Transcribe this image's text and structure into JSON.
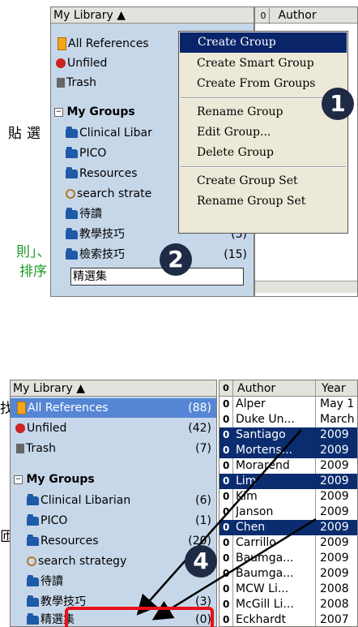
{
  "top": {
    "library_header": "My Library ▲",
    "col_author": "Author",
    "clip_header": "0",
    "nav": [
      {
        "label": "All References"
      },
      {
        "label": "Unfiled"
      },
      {
        "label": "Trash"
      }
    ],
    "groups_title": "My Groups",
    "groups": [
      {
        "label": "Clinical Libar",
        "count": ""
      },
      {
        "label": "PICO",
        "count": ""
      },
      {
        "label": "Resources",
        "count": ""
      },
      {
        "label": "search strate",
        "count": ""
      },
      {
        "label": "待讀",
        "count": ""
      },
      {
        "label": "教學技巧",
        "count": "(3)"
      },
      {
        "label": "檢索技巧",
        "count": "(15)"
      }
    ],
    "new_group_input": "精選集",
    "context_menu": [
      "Create Group",
      "Create Smart Group",
      "Create From Groups",
      "Rename Group",
      "Edit Group...",
      "Delete Group",
      "Create Group Set",
      "Rename Group Set"
    ],
    "badge1": "1",
    "badge2": "2"
  },
  "side_text": {
    "t1": "貼選",
    "t2": "則」、",
    "t3": "排序",
    "t4": "找",
    "t5": "匝"
  },
  "bottom": {
    "library_header": "My Library ▲",
    "nav": [
      {
        "label": "All References",
        "count": "(88)"
      },
      {
        "label": "Unfiled",
        "count": "(42)"
      },
      {
        "label": "Trash",
        "count": "(7)"
      }
    ],
    "groups_title": "My Groups",
    "groups": [
      {
        "label": "Clinical Libarian",
        "count": "(6)"
      },
      {
        "label": "PICO",
        "count": "(1)"
      },
      {
        "label": "Resources",
        "count": "(20)"
      },
      {
        "label": "search strategy",
        "count": ""
      },
      {
        "label": "待讀",
        "count": ""
      },
      {
        "label": "教學技巧",
        "count": "(3)"
      },
      {
        "label": "精選集",
        "count": "(0)"
      }
    ],
    "table_headers": {
      "clip": "0",
      "author": "Author",
      "year": "Year"
    },
    "rows": [
      {
        "author": "Alper",
        "year": "May 1",
        "selected": false
      },
      {
        "author": "Duke Un...",
        "year": "March",
        "selected": false
      },
      {
        "author": "Santiago",
        "year": "2009",
        "selected": true
      },
      {
        "author": "Mortens...",
        "year": "2009",
        "selected": true
      },
      {
        "author": "Morarend",
        "year": "2009",
        "selected": false
      },
      {
        "author": "Lim",
        "year": "2009",
        "selected": true
      },
      {
        "author": "Kim",
        "year": "2009",
        "selected": false
      },
      {
        "author": "Janson",
        "year": "2009",
        "selected": false
      },
      {
        "author": "Chen",
        "year": "2009",
        "selected": true
      },
      {
        "author": "Carrillo",
        "year": "2009",
        "selected": false
      },
      {
        "author": "Baumga...",
        "year": "2009",
        "selected": false
      },
      {
        "author": "Baumga...",
        "year": "2009",
        "selected": false
      },
      {
        "author": "MCW Li...",
        "year": "2008",
        "selected": false
      },
      {
        "author": "McGill Li...",
        "year": "2008",
        "selected": false
      },
      {
        "author": "Eckhardt",
        "year": "2007",
        "selected": false
      }
    ],
    "badge4": "4"
  },
  "colors": {
    "panel_bg": "#c7d7ea",
    "selection": "#0b2d6f",
    "highlight_box": "#e8101a",
    "badge": "#1f2a44",
    "green_text": "#1a9a2a"
  }
}
